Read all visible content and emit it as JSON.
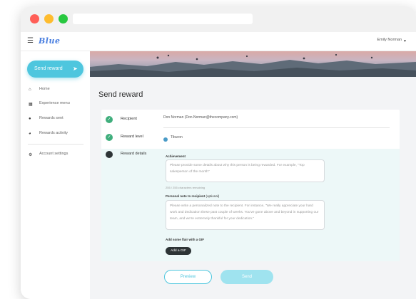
{
  "header": {
    "logo_text": "Blue",
    "user_name": "Emily Norman"
  },
  "sidebar": {
    "send_reward_label": "Send reward",
    "items": [
      {
        "label": "Home",
        "icon": "home-icon"
      },
      {
        "label": "Experience menu",
        "icon": "grid-icon"
      },
      {
        "label": "Rewards sent",
        "icon": "check-icon"
      },
      {
        "label": "Rewards activity",
        "icon": "activity-icon"
      },
      {
        "label": "Account settings",
        "icon": "gear-icon"
      }
    ]
  },
  "main": {
    "page_title": "Send reward",
    "steps": [
      {
        "label": "Recipient",
        "value": "Don Norman (Don.Norman@thecompany.com)",
        "status": "done"
      },
      {
        "label": "Reward level",
        "value": "Tiburon",
        "status": "done"
      },
      {
        "label": "Reward details",
        "value": "",
        "status": "current"
      }
    ],
    "achievement": {
      "title": "Achievement",
      "placeholder": "Please provide some details about why this person is being rewarded. For example, \"Top salesperson of the month\"",
      "helper": "255 / 255 characters remaining"
    },
    "note": {
      "title": "Personal note to recipient",
      "optional": "(optional)",
      "placeholder": "Please write a personalized note to the recipient. For instance, \"We really appreciate your hard work and dedication these past couple of weeks. You've gone above and beyond in supporting our team, and we're extremely thankful for your dedication.\""
    },
    "gif": {
      "title": "Add some flair with a GIF",
      "button_label": "Add a GIF"
    },
    "buttons": {
      "preview": "Preview",
      "send": "Send"
    }
  },
  "colors": {
    "accent": "#4ec6de",
    "success": "#3fae7c",
    "dark": "#2d3436",
    "panel": "#edf8f8"
  }
}
